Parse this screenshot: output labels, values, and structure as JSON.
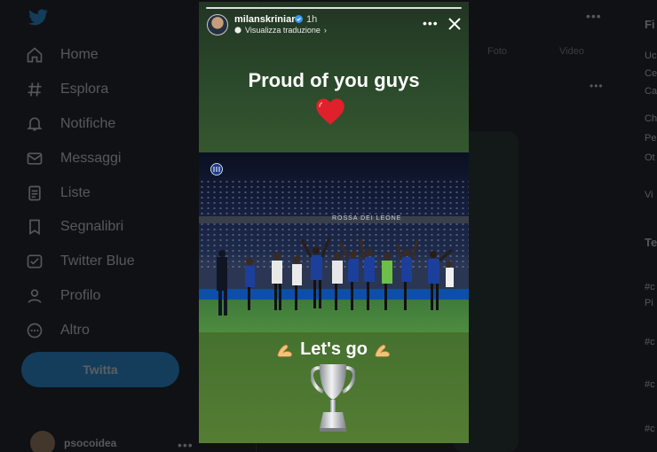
{
  "sidebar": {
    "items": [
      {
        "label": "Home",
        "icon": "home-icon"
      },
      {
        "label": "Esplora",
        "icon": "hashtag-icon"
      },
      {
        "label": "Notifiche",
        "icon": "bell-icon"
      },
      {
        "label": "Messaggi",
        "icon": "envelope-icon"
      },
      {
        "label": "Liste",
        "icon": "list-icon"
      },
      {
        "label": "Segnalibri",
        "icon": "bookmark-icon"
      },
      {
        "label": "Twitter Blue",
        "icon": "twitter-blue-icon"
      },
      {
        "label": "Profilo",
        "icon": "user-icon"
      },
      {
        "label": "Altro",
        "icon": "more-circle-icon"
      }
    ],
    "tweet_button": "Twitta",
    "account_name": "psocoidea"
  },
  "timeline": {
    "tabs": [
      "Foto",
      "Video"
    ]
  },
  "story": {
    "username": "milanskriniar",
    "time": "1h",
    "translate_label": "Visualizza traduzione",
    "caption_top": "Proud of you guys",
    "caption_bottom": "Let's go",
    "stadium_banner": "ROSSA DEI LEONE"
  },
  "right_column": {
    "snippets": [
      "Fi",
      "Uc",
      "Ce",
      "Ca",
      "Ch",
      "Pe",
      "Ot",
      "Vi",
      "Te",
      "#c",
      "Pi",
      "#c",
      "#c",
      "#c"
    ]
  },
  "colors": {
    "accent": "#1d9bf0",
    "background": "#0f1114",
    "story_green": "#32512f",
    "heart_red": "#e0202a"
  }
}
